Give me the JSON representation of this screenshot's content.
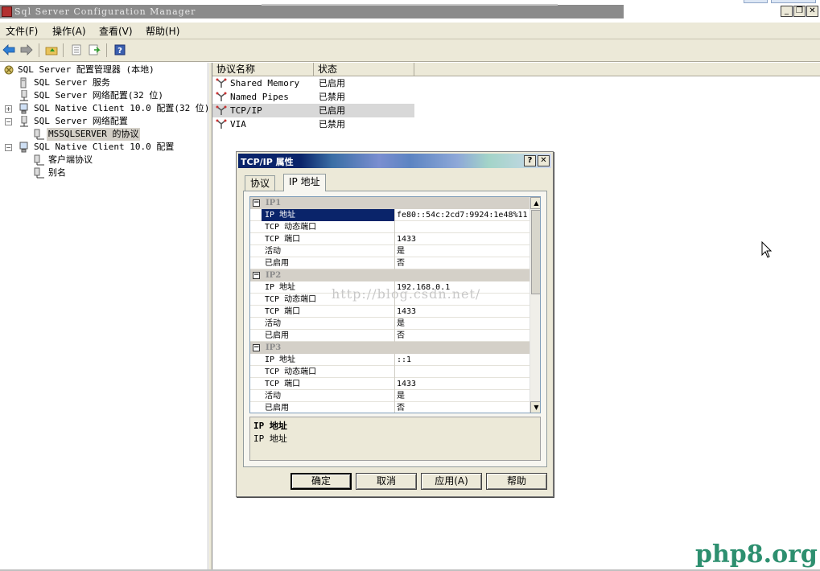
{
  "window": {
    "title": "Sql Server Configuration Manager",
    "buttons": {
      "minimize": "_",
      "restore": "❐",
      "close": "✕"
    }
  },
  "menu": [
    "文件(F)",
    "操作(A)",
    "查看(V)",
    "帮助(H)"
  ],
  "tree": {
    "root": "SQL Server 配置管理器 (本地)",
    "items": [
      "SQL Server 服务",
      "SQL Server 网络配置(32 位)",
      "SQL Native Client 10.0 配置(32 位)",
      "SQL Server 网络配置",
      "MSSQLSERVER 的协议",
      "SQL Native Client 10.0 配置",
      "客户端协议",
      "别名"
    ],
    "toggles": {
      "expand": "+",
      "collapse": "−"
    }
  },
  "list": {
    "columns": [
      "协议名称",
      "状态"
    ],
    "rows": [
      {
        "name": "Shared Memory",
        "status": "已启用"
      },
      {
        "name": "Named Pipes",
        "status": "已禁用"
      },
      {
        "name": "TCP/IP",
        "status": "已启用"
      },
      {
        "name": "VIA",
        "status": "已禁用"
      }
    ]
  },
  "dialog": {
    "title": "TCP/IP 属性",
    "help_glyph": "?",
    "close_glyph": "✕",
    "tabs": [
      "协议",
      "IP 地址"
    ],
    "groups": [
      {
        "name": "IP1",
        "props": [
          {
            "name": "IP 地址",
            "value": "fe80::54c:2cd7:9924:1e48%11"
          },
          {
            "name": "TCP 动态端口",
            "value": ""
          },
          {
            "name": "TCP 端口",
            "value": "1433"
          },
          {
            "name": "活动",
            "value": "是"
          },
          {
            "name": "已启用",
            "value": "否"
          }
        ]
      },
      {
        "name": "IP2",
        "props": [
          {
            "name": "IP 地址",
            "value": "192.168.0.1"
          },
          {
            "name": "TCP 动态端口",
            "value": ""
          },
          {
            "name": "TCP 端口",
            "value": "1433"
          },
          {
            "name": "活动",
            "value": "是"
          },
          {
            "name": "已启用",
            "value": "否"
          }
        ]
      },
      {
        "name": "IP3",
        "props": [
          {
            "name": "IP 地址",
            "value": "::1"
          },
          {
            "name": "TCP 动态端口",
            "value": ""
          },
          {
            "name": "TCP 端口",
            "value": "1433"
          },
          {
            "name": "活动",
            "value": "是"
          },
          {
            "name": "已启用",
            "value": "否"
          }
        ]
      }
    ],
    "description": {
      "title": "IP 地址",
      "text": "IP 地址"
    },
    "buttons": {
      "ok": "确定",
      "cancel": "取消",
      "apply": "应用(A)",
      "help": "帮助"
    }
  },
  "watermarks": {
    "url": "http://blog.csdn.net/",
    "site": "php8.org"
  },
  "colors": {
    "dialog_title": "#0a246a",
    "selection": "#0a246a",
    "watermark_site": "#2d8f6f"
  }
}
